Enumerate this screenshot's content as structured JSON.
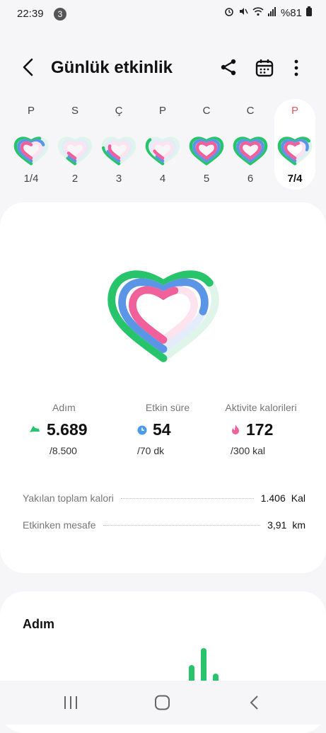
{
  "status_bar": {
    "time": "22:39",
    "notification_count": "3",
    "battery": "%81"
  },
  "header": {
    "title": "Günlük etkinlik"
  },
  "days": [
    {
      "dow": "P",
      "num": "1/4",
      "selected": false
    },
    {
      "dow": "S",
      "num": "2",
      "selected": false
    },
    {
      "dow": "Ç",
      "num": "3",
      "selected": false
    },
    {
      "dow": "P",
      "num": "4",
      "selected": false
    },
    {
      "dow": "C",
      "num": "5",
      "selected": false
    },
    {
      "dow": "C",
      "num": "6",
      "selected": false
    },
    {
      "dow": "P",
      "num": "7/4",
      "selected": true
    }
  ],
  "stats": {
    "steps": {
      "label": "Adım",
      "value": "5.689",
      "goal": "/8.500"
    },
    "active_time": {
      "label": "Etkin süre",
      "value": "54",
      "goal": "/70 dk"
    },
    "calories": {
      "label": "Aktivite kalorileri",
      "value": "172",
      "goal": "/300 kal"
    }
  },
  "details": {
    "total_cal_label": "Yakılan toplam kalori",
    "total_cal_value": "1.406",
    "total_cal_unit": "Kal",
    "distance_label": "Etkinken mesafe",
    "distance_value": "3,91",
    "distance_unit": "km"
  },
  "steps_card": {
    "title": "Adım"
  },
  "colors": {
    "green": "#27c46b",
    "blue": "#5b95e6",
    "pink": "#f0609a",
    "selected_day": "#e35a5a"
  }
}
